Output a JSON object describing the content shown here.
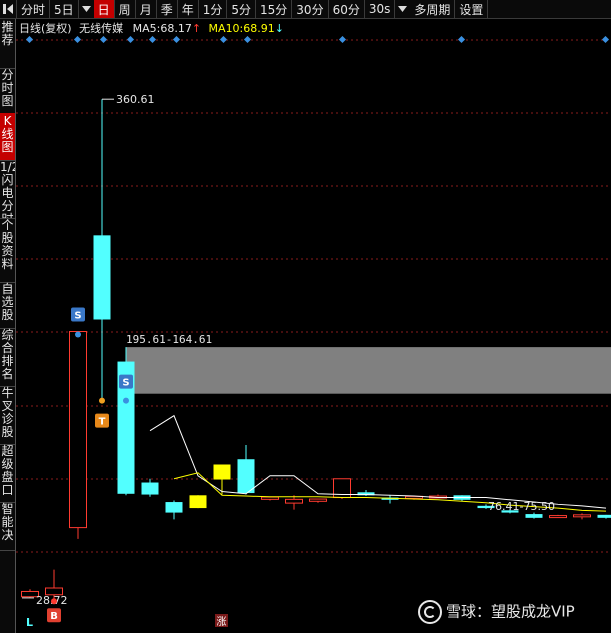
{
  "toolbar": {
    "items": [
      "分时",
      "5日",
      "日",
      "周",
      "月",
      "季",
      "年",
      "1分",
      "5分",
      "15分",
      "30分",
      "60分",
      "30s",
      "多周期",
      "设置"
    ],
    "active": "日"
  },
  "sidebar": {
    "items": [
      "推荐",
      "分时图",
      "K线图",
      "1/2闪电分时",
      "个股资料",
      "自选股",
      "综合排名",
      "牛叉诊股",
      "超级盘口",
      "智能决"
    ],
    "active": "K线图"
  },
  "info": {
    "mode": "日线(复权)",
    "stock_name": "无线传媒",
    "ma5_label": "MA5:",
    "ma5_value": "68.17",
    "ma5_arrow": "↑",
    "ma10_label": "MA10:",
    "ma10_value": "68.91",
    "ma10_arrow": "↓"
  },
  "colors": {
    "up": "#ff3b30",
    "down": "#52ffff",
    "ma5": "#ffffff",
    "ma10": "#ffff00",
    "zone": "#808080",
    "marker_blue": "#3a78c8",
    "marker_orange": "#e8891a",
    "grid": "#8a1c1c"
  },
  "chart_data": {
    "type": "candlestick",
    "price_ylim": [
      20.0,
      400.0
    ],
    "annotations": {
      "high_label": "360.61",
      "low_label": "28.72",
      "zone_label": "195.61-164.61",
      "range_label": "76.41-75.50"
    },
    "zone": {
      "top": 195.61,
      "bottom": 164.61
    },
    "candles": [
      {
        "o": 33.0,
        "c": 29.5,
        "h": 34.5,
        "l": 28.7,
        "dir": "up"
      },
      {
        "o": 35.3,
        "c": 30.8,
        "h": 47.5,
        "l": 26.5,
        "dir": "up"
      },
      {
        "o": 75.5,
        "c": 206.0,
        "h": 206.0,
        "l": 68.0,
        "dir": "up"
      },
      {
        "o": 270.0,
        "c": 214.0,
        "h": 360.61,
        "l": 160.0,
        "dir": "down"
      },
      {
        "o": 186.0,
        "c": 98.0,
        "h": 195.6,
        "l": 97.0,
        "dir": "down"
      },
      {
        "o": 105.5,
        "c": 97.5,
        "h": 108.0,
        "l": 96.0,
        "dir": "down"
      },
      {
        "o": 92.5,
        "c": 85.5,
        "h": 93.5,
        "l": 81.0,
        "dir": "down"
      },
      {
        "o": 97.0,
        "c": 88.5,
        "h": 97.0,
        "l": 88.5,
        "dir": "flat-y"
      },
      {
        "o": 117.5,
        "c": 107.5,
        "h": 117.5,
        "l": 97.5,
        "dir": "flat-y"
      },
      {
        "o": 121.0,
        "c": 98.5,
        "h": 130.5,
        "l": 97.5,
        "dir": "down"
      },
      {
        "o": 94.3,
        "c": 95.8,
        "h": 95.8,
        "l": 93.5,
        "dir": "up"
      },
      {
        "o": 91.8,
        "c": 94.3,
        "h": 97.0,
        "l": 87.5,
        "dir": "up"
      },
      {
        "o": 93.0,
        "c": 94.5,
        "h": 94.5,
        "l": 92.0,
        "dir": "up"
      },
      {
        "o": 95.5,
        "c": 108.0,
        "h": 108.0,
        "l": 94.5,
        "dir": "up"
      },
      {
        "o": 99.0,
        "c": 97.0,
        "h": 100.5,
        "l": 96.5,
        "dir": "down"
      },
      {
        "o": 95.5,
        "c": 94.0,
        "h": 97.0,
        "l": 91.5,
        "dir": "down"
      },
      {
        "o": 95.3,
        "c": 96.3,
        "h": 96.3,
        "l": 94.0,
        "dir": "up"
      },
      {
        "o": 95.5,
        "c": 96.5,
        "h": 97.5,
        "l": 95.0,
        "dir": "up"
      },
      {
        "o": 97.0,
        "c": 94.0,
        "h": 97.0,
        "l": 93.0,
        "dir": "down"
      },
      {
        "o": 90.0,
        "c": 88.5,
        "h": 91.0,
        "l": 88.0,
        "dir": "down"
      },
      {
        "o": 87.0,
        "c": 85.5,
        "h": 88.0,
        "l": 85.0,
        "dir": "down"
      },
      {
        "o": 84.5,
        "c": 82.0,
        "h": 85.5,
        "l": 81.5,
        "dir": "down"
      },
      {
        "o": 82.5,
        "c": 83.5,
        "h": 84.0,
        "l": 82.0,
        "dir": "up"
      },
      {
        "o": 83.0,
        "c": 84.0,
        "h": 85.0,
        "l": 81.0,
        "dir": "up"
      },
      {
        "o": 84.0,
        "c": 82.0,
        "h": 84.0,
        "l": 81.5,
        "dir": "down"
      }
    ],
    "ma5": [
      140.0,
      150.0,
      110.0,
      99.5,
      98.0,
      110.0,
      110.0,
      98.0,
      97.5,
      97.5,
      97.0,
      96.5,
      95.5,
      95.5,
      95.5,
      94.0,
      92.5,
      91.0,
      90.0,
      88.5
    ],
    "ma10": [
      108.0,
      112.0,
      97.0,
      96.5,
      96.0,
      96.0,
      96.0,
      95.5,
      95.5,
      95.0,
      94.5,
      94.0,
      93.0,
      92.0,
      90.5,
      89.5,
      88.5,
      87.0,
      86.5
    ],
    "signals": [
      {
        "label": "S",
        "kind": "sell",
        "candle": 3
      },
      {
        "label": "T",
        "kind": "t",
        "candle": 4
      },
      {
        "label": "S",
        "kind": "sell",
        "candle": 4
      },
      {
        "label": "B",
        "kind": "buy",
        "candle": 1
      }
    ]
  },
  "bottom": {
    "l_label": "L",
    "zhang_label": "涨"
  },
  "watermark": {
    "text": "雪球：望股成龙VIP"
  }
}
